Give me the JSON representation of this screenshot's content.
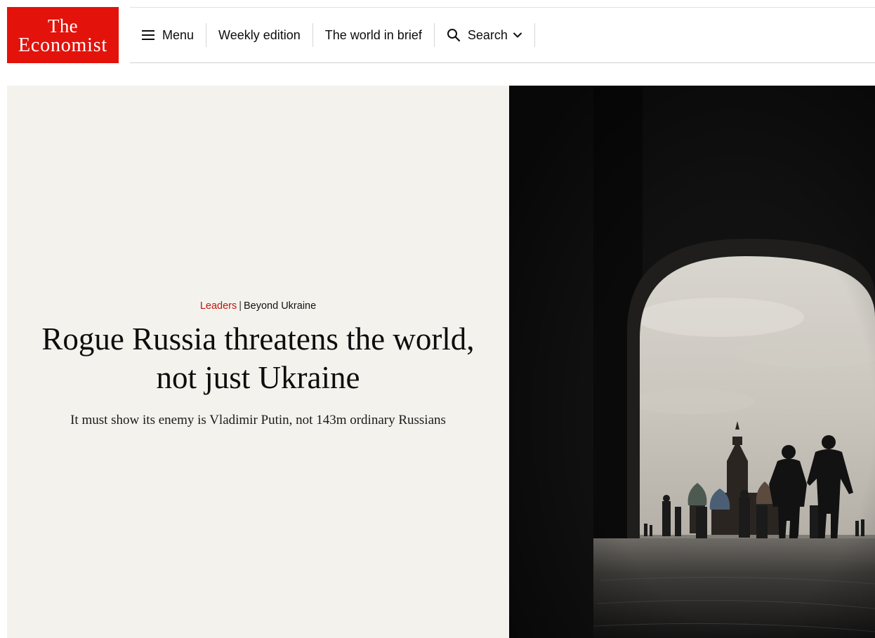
{
  "brand": {
    "logo_line1": "The",
    "logo_line2": "Economist",
    "color": "#e3120b"
  },
  "nav": {
    "menu_label": "Menu",
    "menu_icon": "hamburger-icon",
    "weekly_edition": "Weekly edition",
    "world_in_brief": "The world in brief",
    "search_label": "Search",
    "search_icon": "search-icon",
    "search_dropdown_icon": "chevron-down-icon"
  },
  "article": {
    "section": "Leaders",
    "separator": "|",
    "topic": "Beyond Ukraine",
    "headline": "Rogue Russia threatens the world, not just Ukraine",
    "subheadline": "It must show its enemy is Vladimir Putin, not 143m ordinary Russians",
    "section_color": "#c1140e",
    "panel_color": "#f4f2ec"
  },
  "image": {
    "description_icon": "archway-photo",
    "subject": "silhouetted couple walking through an archway toward St Basil's Cathedral"
  }
}
